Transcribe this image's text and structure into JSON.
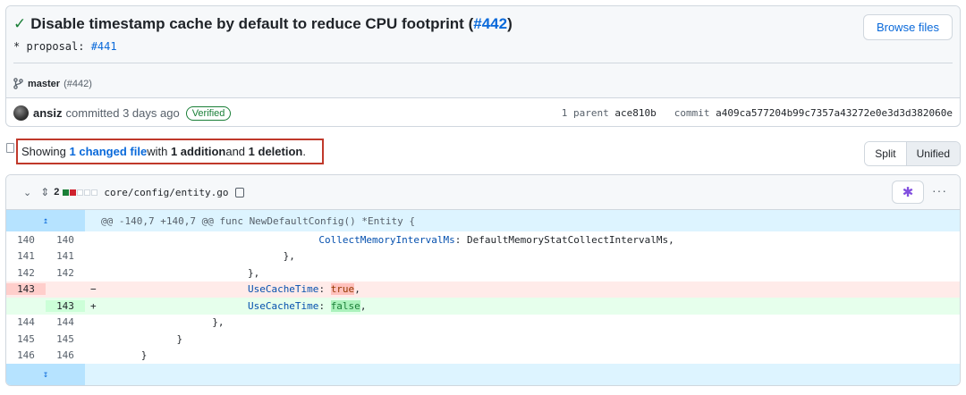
{
  "commit": {
    "check_icon": "check-icon",
    "title": "Disable timestamp cache by default to reduce CPU footprint (",
    "issue": "#442",
    "title_end": ")",
    "browse_label": "Browse files",
    "description_prefix": "* proposal: ",
    "description_link": "#441",
    "branch": "master",
    "branch_pr": "(#442)",
    "author": "ansiz",
    "committed_text": "committed 3 days ago",
    "verified_label": "Verified",
    "parent_label": "1 parent",
    "parent_sha": "ace810b",
    "commit_label": "commit",
    "commit_sha": "a409ca577204b99c7357a43272e0e3d3d382060e"
  },
  "summary": {
    "prefix": "Showing ",
    "changed": "1 changed file",
    "with": " with ",
    "additions": "1 addition",
    "and": " and ",
    "deletions": "1 deletion",
    "end": "."
  },
  "view_toggle": {
    "split": "Split",
    "unified": "Unified"
  },
  "file": {
    "change_count": "2",
    "path": "core/config/entity.go",
    "hunk_header": "@@ -140,7 +140,7 @@ func NewDefaultConfig() *Entity {",
    "lines": [
      {
        "old": "140",
        "new": "140",
        "sign": "",
        "code": "                                    CollectMemoryIntervalMs: DefaultMemoryStatCollectIntervalMs,"
      },
      {
        "old": "141",
        "new": "141",
        "sign": "",
        "code": "                              },"
      },
      {
        "old": "142",
        "new": "142",
        "sign": "",
        "code": "                        },"
      },
      {
        "old": "143",
        "new": "",
        "sign": "−",
        "code_pre": "                        ",
        "code_key": "UseCacheTime",
        "code_colon": ": ",
        "code_val": "true",
        "code_end": ","
      },
      {
        "old": "",
        "new": "143",
        "sign": "+",
        "code_pre": "                        ",
        "code_key": "UseCacheTime",
        "code_colon": ": ",
        "code_val": "false",
        "code_end": ","
      },
      {
        "old": "144",
        "new": "144",
        "sign": "",
        "code": "                  },"
      },
      {
        "old": "145",
        "new": "145",
        "sign": "",
        "code": "            }"
      },
      {
        "old": "146",
        "new": "146",
        "sign": "",
        "code": "      }"
      }
    ]
  }
}
